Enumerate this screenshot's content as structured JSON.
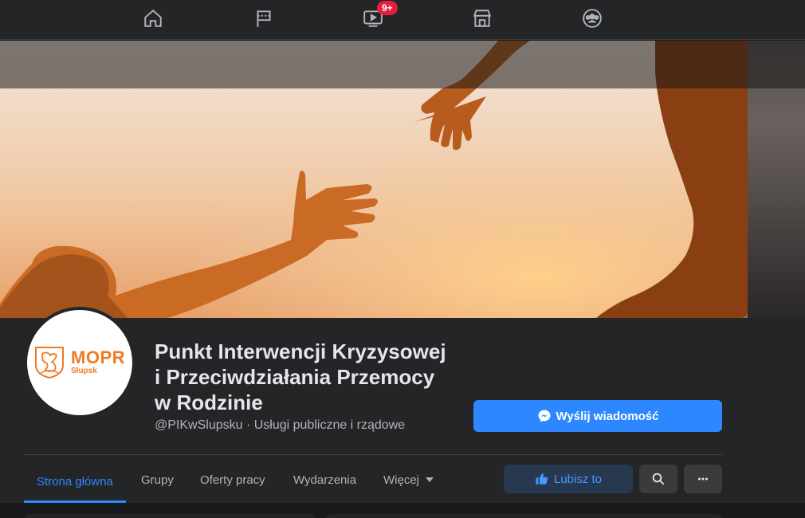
{
  "nav": {
    "icons": [
      "home-icon",
      "flag-icon",
      "watch-icon",
      "marketplace-icon",
      "groups-icon"
    ],
    "watch_badge": "9+"
  },
  "page": {
    "title_lines": [
      "Punkt Interwencji Kryzysowej",
      "i Przeciwdziałania Przemocy",
      "w Rodzinie"
    ],
    "meta": "@PIKwSlupsku · Usługi publiczne i rządowe"
  },
  "logo": {
    "name": "MOPR",
    "city": "Słupsk"
  },
  "actions": {
    "send_message": "Wyślij wiadomość",
    "like": "Lubisz to"
  },
  "tabs": [
    {
      "label": "Strona główna",
      "active": true
    },
    {
      "label": "Grupy",
      "active": false
    },
    {
      "label": "Oferty pracy",
      "active": false
    },
    {
      "label": "Wydarzenia",
      "active": false
    },
    {
      "label": "Więcej",
      "active": false
    }
  ],
  "colors": {
    "accent": "#2d88ff",
    "badge": "#e41e3f",
    "logo": "#f07a22"
  }
}
